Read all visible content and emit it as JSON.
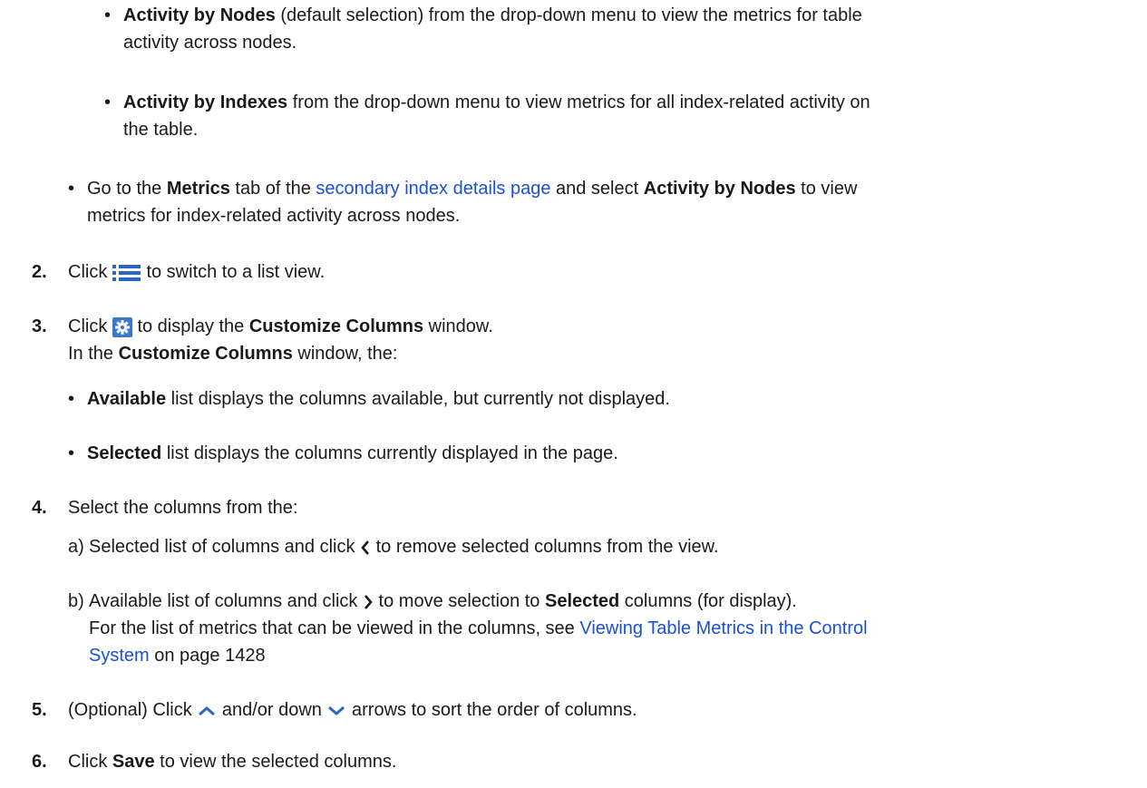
{
  "sub_bullets_top": [
    {
      "bold": "Activity by Nodes",
      "line1": " (default selection) from the drop-down menu to view the metrics for table",
      "line2": "activity across nodes."
    },
    {
      "bold": "Activity by Indexes",
      "line1": " from the drop-down menu to view metrics for all index-related activity on",
      "line2": "the table."
    }
  ],
  "metrics_bullet": {
    "t1": "Go to the ",
    "b1": "Metrics",
    "t2": " tab of the ",
    "link": "secondary index details page",
    "t3": " and select ",
    "b2": "Activity by Nodes",
    "t4": " to view",
    "line2": "metrics for index-related activity across nodes."
  },
  "steps": {
    "s2": {
      "num": "2.",
      "pre": "Click ",
      "post": " to switch to a list view.",
      "icon": "list-view-icon"
    },
    "s3": {
      "num": "3.",
      "pre": "Click ",
      "icon": "gear-settings-icon",
      "post1": " to display the ",
      "bold1": "Customize Columns",
      "post2": " window.",
      "line2_pre": "In the ",
      "line2_bold": "Customize Columns",
      "line2_post": " window, the:",
      "bullets": [
        {
          "bold": "Available",
          "text": " list displays the columns available, but currently not displayed."
        },
        {
          "bold": "Selected",
          "text": " list displays the columns currently displayed in the page."
        }
      ]
    },
    "s4": {
      "num": "4.",
      "text": "Select the columns from the:",
      "a": {
        "label": "a)",
        "pre": "Selected list of columns and click ",
        "post": " to remove selected columns from the view.",
        "icon": "chevron-left-icon"
      },
      "b": {
        "label": "b)",
        "pre": "Available list of columns and click ",
        "icon": "chevron-right-icon",
        "post1": " to move selection to ",
        "bold": "Selected",
        "post2": " columns (for display).",
        "note_pre": "For the list of metrics that can be viewed in the columns, see ",
        "note_link1": "Viewing Table Metrics in the Control",
        "note_link2": "System",
        "note_post": " on page 1428"
      }
    },
    "s5": {
      "num": "5.",
      "pre": "(Optional) Click ",
      "mid": " and/or down ",
      "post": " arrows to sort the order of columns.",
      "icon_up": "chevron-up-icon",
      "icon_down": "chevron-down-icon"
    },
    "s6": {
      "num": "6.",
      "pre": "Click ",
      "bold": "Save",
      "post": " to view the selected columns."
    }
  },
  "colors": {
    "link": "#1a4fd6",
    "icon_blue": "#2c66c4",
    "text": "#1a1a1a"
  }
}
